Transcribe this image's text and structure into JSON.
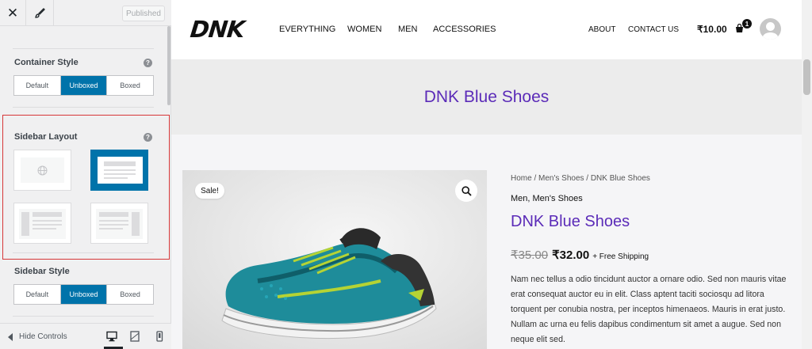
{
  "customizer": {
    "close_icon": "close-icon",
    "brush_icon": "paint-brush-icon",
    "publish_label": "Published",
    "container_style": {
      "title": "Container Style",
      "help": "?",
      "options": [
        "Default",
        "Unboxed",
        "Boxed"
      ],
      "selected": "Unboxed"
    },
    "sidebar_layout": {
      "title": "Sidebar Layout",
      "help": "?",
      "options": [
        "default",
        "no-sidebar",
        "left-sidebar",
        "right-sidebar"
      ],
      "selected": "no-sidebar"
    },
    "sidebar_style": {
      "title": "Sidebar Style",
      "options": [
        "Default",
        "Unboxed",
        "Boxed"
      ],
      "selected": "Unboxed"
    },
    "footer": {
      "hide_controls": "Hide Controls",
      "devices": [
        "desktop",
        "tablet",
        "mobile"
      ],
      "active_device": "desktop"
    }
  },
  "site": {
    "logo": "DNK",
    "nav_main": [
      "EVERYTHING",
      "WOMEN",
      "MEN",
      "ACCESSORIES"
    ],
    "nav_secondary": [
      "ABOUT",
      "CONTACT US"
    ],
    "cart_total": "₹10.00",
    "cart_count": "1",
    "page_title": "DNK Blue Shoes"
  },
  "product": {
    "sale_badge": "Sale!",
    "breadcrumb": "Home / Men's Shoes / DNK Blue Shoes",
    "categories": "Men, Men's Shoes",
    "title": "DNK Blue Shoes",
    "price_old": "₹35.00",
    "price_new": "₹32.00",
    "shipping": "+ Free Shipping",
    "description": "Nam nec tellus a odio tincidunt auctor a ornare odio. Sed non mauris vitae erat consequat auctor eu in elit. Class aptent taciti sociosqu ad litora torquent per conubia nostra, per inceptos himenaeos. Mauris in erat justo. Nullam ac urna eu felis dapibus condimentum sit amet a augue. Sed non neque elit sed."
  },
  "colors": {
    "accent": "#0073aa",
    "brand_purple": "#5b2bb8",
    "highlight_border": "#d63638"
  }
}
